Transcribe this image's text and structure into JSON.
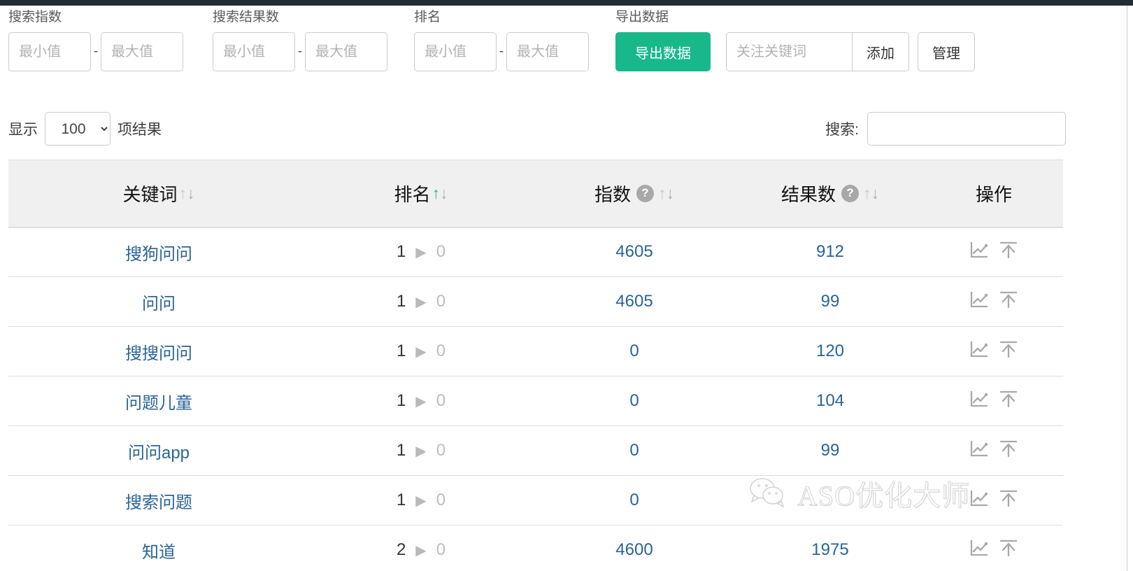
{
  "toolbar": {
    "filters": [
      {
        "label": "搜索指数",
        "min_placeholder": "最小值",
        "max_placeholder": "最大值",
        "min_value": "",
        "max_value": "",
        "separator": "-"
      },
      {
        "label": "搜索结果数",
        "min_placeholder": "最小值",
        "max_placeholder": "最大值",
        "min_value": "",
        "max_value": "",
        "separator": "-"
      },
      {
        "label": "排名",
        "min_placeholder": "最小值",
        "max_placeholder": "最大值",
        "min_value": "",
        "max_value": "",
        "separator": "-"
      }
    ],
    "export": {
      "label": "导出数据",
      "button_label": "导出数据",
      "color": "#18b88a"
    },
    "follow": {
      "placeholder": "关注关键词",
      "value": "",
      "add_label": "添加",
      "manage_label": "管理"
    }
  },
  "length_row": {
    "prefix": "显示",
    "value": "100",
    "suffix": "项结果"
  },
  "search_row": {
    "label": "搜索:",
    "value": "",
    "placeholder": ""
  },
  "table": {
    "columns": [
      {
        "key": "keyword",
        "label": "关键词",
        "has_help": false,
        "sort": "none"
      },
      {
        "key": "rank",
        "label": "排名",
        "has_help": false,
        "sort": "asc"
      },
      {
        "key": "index",
        "label": "指数",
        "has_help": true,
        "sort": "none"
      },
      {
        "key": "results",
        "label": "结果数",
        "has_help": true,
        "sort": "none"
      },
      {
        "key": "actions",
        "label": "操作",
        "has_help": false,
        "sort": "none"
      }
    ],
    "sort_up_glyph": "↑",
    "sort_down_glyph": "↓",
    "help_glyph": "?",
    "rank_arrow_glyph": "▶",
    "action_icons": [
      "line-chart-icon",
      "rank-top-arrow-icon"
    ],
    "rows": [
      {
        "keyword": "搜狗问问",
        "rank": "1",
        "rank_prev": "0",
        "index": "4605",
        "results": "912"
      },
      {
        "keyword": "问问",
        "rank": "1",
        "rank_prev": "0",
        "index": "4605",
        "results": "99"
      },
      {
        "keyword": "搜搜问问",
        "rank": "1",
        "rank_prev": "0",
        "index": "0",
        "results": "120"
      },
      {
        "keyword": "问题儿童",
        "rank": "1",
        "rank_prev": "0",
        "index": "0",
        "results": "104"
      },
      {
        "keyword": "问问app",
        "rank": "1",
        "rank_prev": "0",
        "index": "0",
        "results": "99"
      },
      {
        "keyword": "搜索问题",
        "rank": "1",
        "rank_prev": "0",
        "index": "0",
        "results": ""
      },
      {
        "keyword": "知道",
        "rank": "2",
        "rank_prev": "0",
        "index": "4600",
        "results": "1975"
      }
    ]
  },
  "watermark": {
    "text": "ASO优化大师",
    "icon": "wechat-icon"
  }
}
